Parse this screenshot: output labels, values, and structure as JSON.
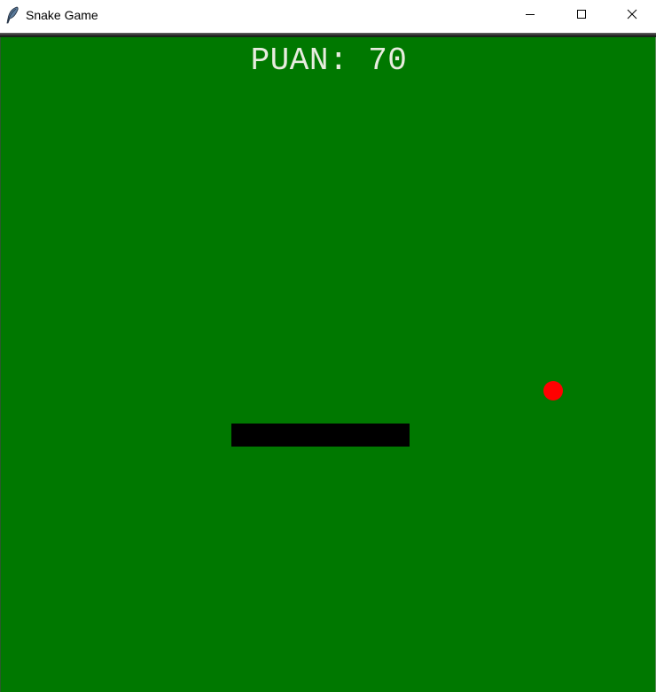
{
  "window": {
    "title": "Snake Game",
    "app_icon": "feather-icon",
    "controls": [
      "minimize-icon",
      "maximize-icon",
      "close-icon"
    ]
  },
  "game": {
    "score_text": "PUAN: 70",
    "colors": {
      "background": "#007800",
      "snake": "#000000",
      "food": "#ff0000",
      "score_text": "#e8ecdf"
    },
    "snake": {
      "direction": "horizontal",
      "segments": 5
    },
    "food": {
      "shape": "circle"
    }
  }
}
